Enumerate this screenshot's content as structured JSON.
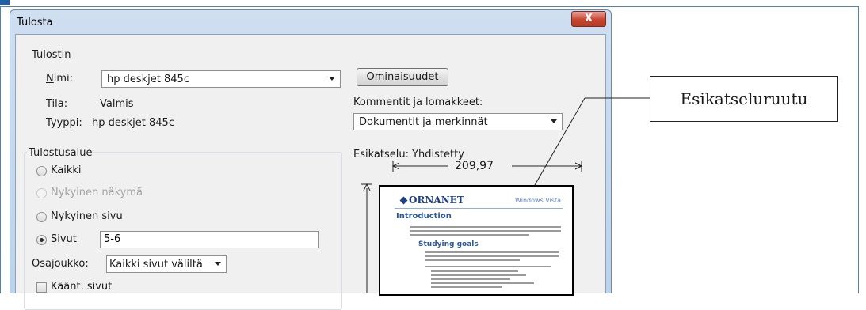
{
  "dialog": {
    "title": "Tulosta",
    "close_label": "X"
  },
  "printer": {
    "group_label": "Tulostin",
    "name_label": "Nimi:",
    "name_label_underline": "N",
    "name_label_rest": "imi:",
    "name_value": "hp deskjet 845c",
    "status_label": "Tila:",
    "status_value": "Valmis",
    "type_label": "Tyyppi:",
    "type_value": "hp deskjet 845c",
    "properties_button": "Ominaisuudet",
    "comments_label": "Kommentit ja lomakkeet:",
    "comments_value": "Dokumentit ja merkinnät"
  },
  "print_range": {
    "group_label": "Tulostusalue",
    "all": "Kaikki",
    "current_view": "Nykyinen näkymä",
    "current_page": "Nykyinen sivu",
    "pages": "Sivut",
    "pages_value": "5-6",
    "subset_label": "Osajoukko:",
    "subset_value": "Kaikki sivut väliltä",
    "reverse_pages": "Käänt. sivut"
  },
  "preview": {
    "label": "Esikatselu: Yhdistetty",
    "width_value": "209,97",
    "doc_logo": "ORNANET",
    "doc_header_right": "Windows Vista",
    "doc_intro": "Introduction",
    "doc_section": "Studying goals"
  },
  "annotation": {
    "callout": "Esikatseluruutu"
  }
}
